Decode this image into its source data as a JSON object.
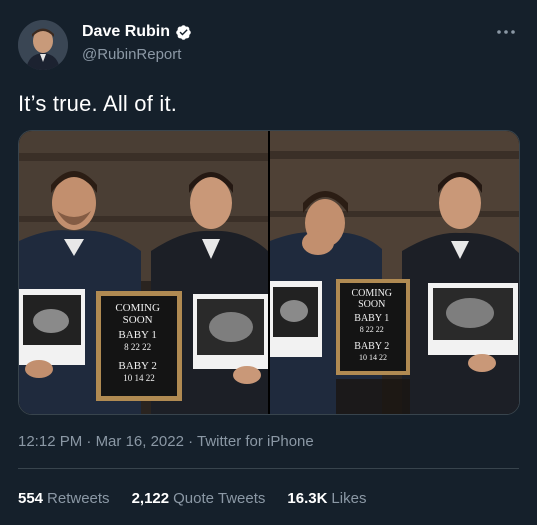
{
  "author": {
    "name": "Dave Rubin",
    "handle": "@RubinReport"
  },
  "tweet": {
    "text": "It’s true. All of it."
  },
  "photos": {
    "left": {
      "board_lines": [
        "COMING",
        "SOON",
        "BABY 1",
        "8 22 22",
        "BABY 2",
        "10 14 22"
      ]
    },
    "right": {
      "board_lines": [
        "COMING",
        "SOON",
        "BABY 1",
        "8 22 22",
        "BABY 2",
        "10 14 22"
      ]
    }
  },
  "meta": {
    "time": "12:12 PM",
    "sep1": " · ",
    "date": "Mar 16, 2022",
    "sep2": " · ",
    "source": "Twitter for iPhone"
  },
  "stats": {
    "retweets": {
      "count": "554",
      "label": "Retweets"
    },
    "quotes": {
      "count": "2,122",
      "label": "Quote Tweets"
    },
    "likes": {
      "count": "16.3K",
      "label": "Likes"
    }
  },
  "colors": {
    "background": "#15202b",
    "secondary_text": "#8b98a5",
    "verified": "#1d9bf0",
    "border": "#38444d"
  },
  "icons": [
    "verified-badge-icon",
    "more-options-icon"
  ]
}
